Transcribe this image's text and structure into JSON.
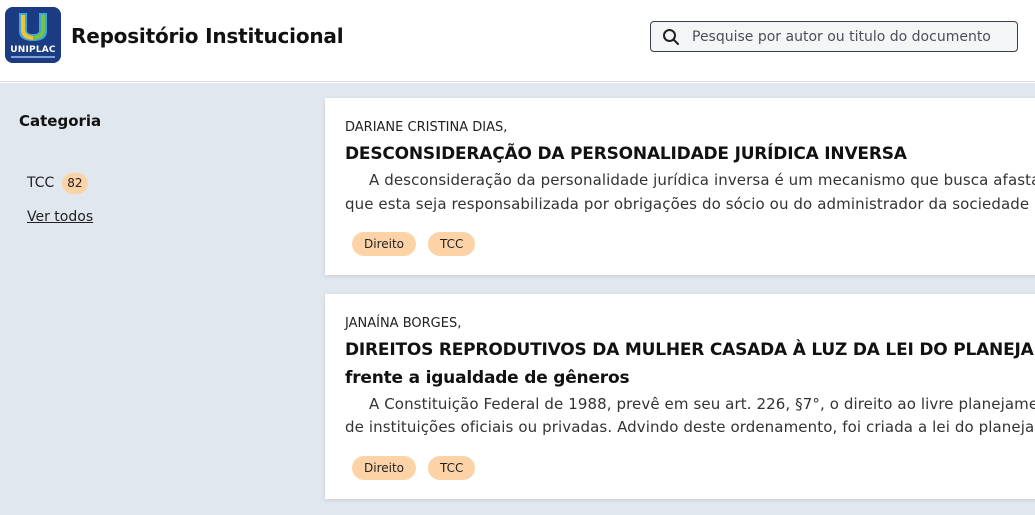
{
  "header": {
    "logo_text": "UNIPLAC",
    "title": "Repositório Institucional",
    "search_placeholder": "Pesquise por autor ou titulo do documento"
  },
  "sidebar": {
    "heading": "Categoria",
    "items": [
      {
        "label": "TCC",
        "count": "82"
      }
    ],
    "see_all": "Ver todos"
  },
  "results": [
    {
      "author": "DARIANE CRISTINA DIAS,",
      "title_lines": [
        "DESCONSIDERAÇÃO DA PERSONALIDADE JURÍDICA INVERSA"
      ],
      "abstract_lines": [
        "A desconsideração da personalidade jurídica inversa é um mecanismo que busca afastar",
        "que esta seja responsabilizada por obrigações do sócio ou do administrador da sociedade por"
      ],
      "tags": [
        "Direito",
        "TCC"
      ]
    },
    {
      "author": "JANAÍNA BORGES,",
      "title_lines": [
        "DIREITOS REPRODUTIVOS DA MULHER CASADA À LUZ DA LEI DO PLANEJAMENTO",
        "frente a igualdade de gêneros"
      ],
      "abstract_lines": [
        "A Constituição Federal de 1988, prevê em seu art. 226, §7°, o direito ao livre planejamento",
        "de instituições oficiais ou privadas. Advindo deste ordenamento, foi criada a lei do planejamen"
      ],
      "tags": [
        "Direito",
        "TCC"
      ]
    }
  ],
  "colors": {
    "sidebar_bg": "#e1e7ef",
    "badge_bg": "#fcd3a6",
    "logo_bg": "#1b3c83"
  },
  "icons": {
    "search": "search-icon",
    "logo": "uniplac-logo"
  }
}
